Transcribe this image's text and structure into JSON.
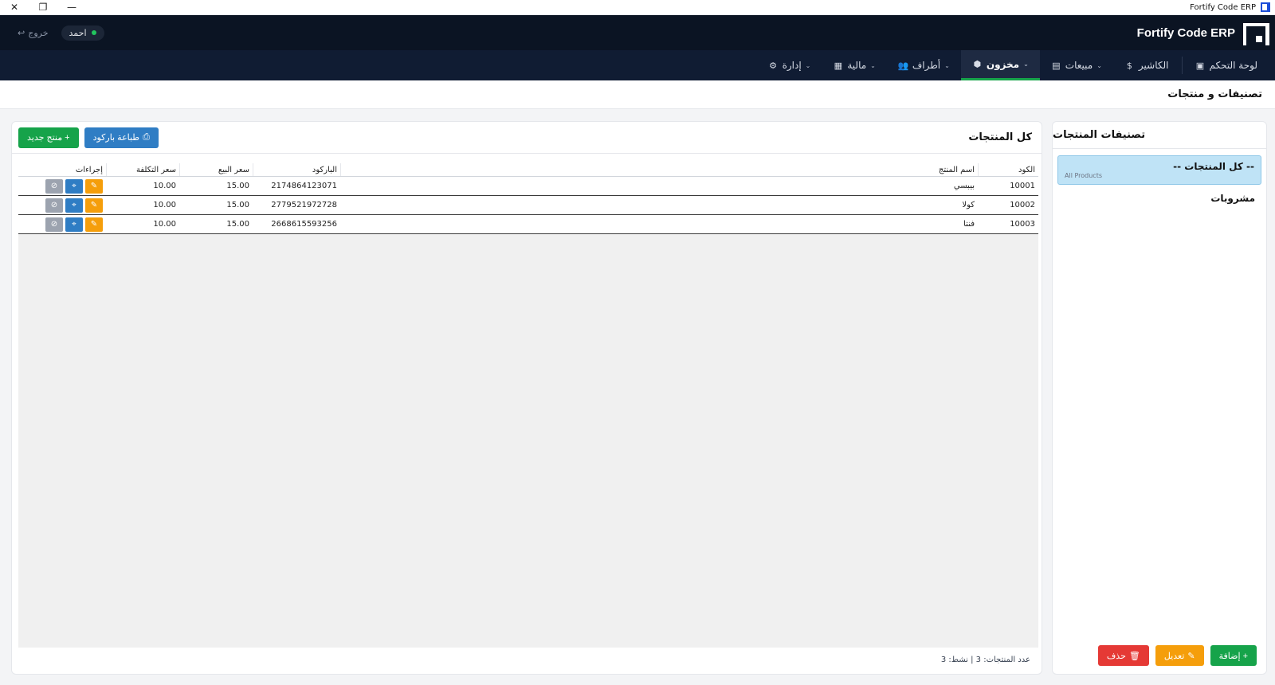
{
  "window": {
    "title": "Fortify Code ERP",
    "close_glyph": "✕",
    "restore_glyph": "❐",
    "minimize_glyph": "—"
  },
  "appbar": {
    "brand": "Fortify Code ERP",
    "logout_label": "خروج",
    "logout_icon": "↩",
    "user_name": "احمد",
    "status_color": "#22c55e"
  },
  "nav": {
    "items": [
      {
        "label": "لوحة التحكم",
        "icon": "dashboard-icon",
        "glyph": "▣",
        "dropdown": false
      },
      {
        "label": "الكاشير",
        "icon": "cashier-icon",
        "glyph": "$",
        "dropdown": false
      },
      {
        "label": "مبيعات",
        "icon": "receipt-icon",
        "glyph": "▤",
        "dropdown": true
      },
      {
        "label": "مخزون",
        "icon": "box-icon",
        "glyph": "⬢",
        "dropdown": true,
        "active": true
      },
      {
        "label": "أطراف",
        "icon": "users-icon",
        "glyph": "👥",
        "dropdown": true
      },
      {
        "label": "مالية",
        "icon": "calculator-icon",
        "glyph": "▦",
        "dropdown": true
      },
      {
        "label": "إدارة",
        "icon": "gear-icon",
        "glyph": "⚙",
        "dropdown": true
      }
    ],
    "chevron": "⌄"
  },
  "page": {
    "title": "تصنيفات و منتجات"
  },
  "categories": {
    "title": "تصنيفات المنتجات",
    "items": [
      {
        "label": "-- كل المنتجات --",
        "sub": "All Products",
        "selected": true
      },
      {
        "label": "مشروبات",
        "sub": "",
        "selected": false
      }
    ],
    "buttons": {
      "add": "+ إضافة",
      "edit": "تعديل",
      "delete": "حذف"
    }
  },
  "products": {
    "title": "كل المنتجات",
    "buttons": {
      "print_barcode": "طباعة باركود",
      "new_product": "+ منتج جديد"
    },
    "columns": {
      "code": "الكود",
      "name": "اسم المنتج",
      "barcode": "الباركود",
      "sale_price": "سعر البيع",
      "cost_price": "سعر التكلفة",
      "actions": "إجراءات"
    },
    "rows": [
      {
        "code": "10001",
        "name": "بيبسي",
        "barcode": "2174864123071",
        "sale_price": "15.00",
        "cost_price": "10.00"
      },
      {
        "code": "10002",
        "name": "كولا",
        "barcode": "2779521972728",
        "sale_price": "15.00",
        "cost_price": "10.00"
      },
      {
        "code": "10003",
        "name": "فنتا",
        "barcode": "2668615593256",
        "sale_price": "15.00",
        "cost_price": "10.00"
      }
    ],
    "footer": "عدد المنتجات: 3 | نشط: 3"
  }
}
